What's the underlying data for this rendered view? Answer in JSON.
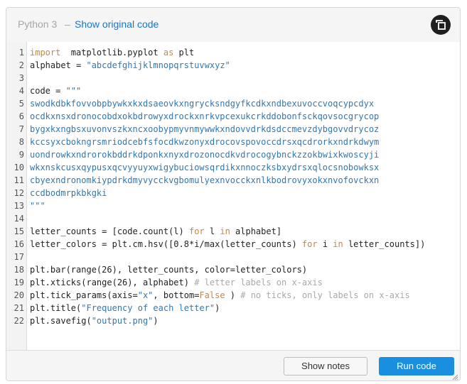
{
  "header": {
    "language": "Python 3",
    "separator": "–",
    "show_original_label": "Show original code",
    "expand_icon": "expand-icon"
  },
  "code": {
    "line_numbers": [
      "1",
      "2",
      "3",
      "4",
      "5",
      "6",
      "7",
      "8",
      "9",
      "10",
      "11",
      "12",
      "13",
      "14",
      "15",
      "16",
      "17",
      "18",
      "19",
      "20",
      "21",
      "22"
    ],
    "lines": [
      [
        [
          "kw",
          "import"
        ],
        [
          "",
          "  matplotlib.pyplot "
        ],
        [
          "kw",
          "as"
        ],
        [
          "",
          " plt"
        ]
      ],
      [
        [
          "",
          "alphabet = "
        ],
        [
          "str",
          "\"abcdefghijklmnopqrstuvwxyz\""
        ]
      ],
      [],
      [
        [
          "",
          "code = "
        ],
        [
          "str",
          "\"\"\""
        ]
      ],
      [
        [
          "str",
          "swodkdbkfovvobpbywkxkxdsaeovkxngrycksndgyfkcdkxndbexuvoccvoqcypcdyx"
        ]
      ],
      [
        [
          "str",
          "ocdkxnsxdronocobdxokbdrowyxdrockxnrkvpcexukcrkddobonfsckqovsocgrycop"
        ]
      ],
      [
        [
          "str",
          "bygxkxngbsxuvonvszkxncxoobypmyvnmywwkxndovvdrkdsdccmevzdybgovvdrycoz"
        ]
      ],
      [
        [
          "str",
          "kccsyxcbokngrsmriodcebfsfocdkwzonyxdrocovspovoccdrsxqcdrorkxndrkdwym"
        ]
      ],
      [
        [
          "str",
          "uondrowkxndrorokbddrkdponkxnyxdrozonocdkvdrocogybnckzzokbwixkwoscyji"
        ]
      ],
      [
        [
          "str",
          "wkxnskcusxqypusxqcvyyuyxwigybuciowsqrdikxnnoczksbxydrsxqlocsnobowksx"
        ]
      ],
      [
        [
          "str",
          "cbyexndronomkiypdrkdmyvycckvgbomulyexnvocckxnlkbodrovyxokxnvofovckxn"
        ]
      ],
      [
        [
          "str",
          "ccdbodmrpkbkgki"
        ]
      ],
      [
        [
          "str",
          "\"\"\""
        ]
      ],
      [],
      [
        [
          "",
          "letter_counts = [code.count(l) "
        ],
        [
          "kw",
          "for"
        ],
        [
          "",
          " l "
        ],
        [
          "kw",
          "in"
        ],
        [
          "",
          " alphabet]"
        ]
      ],
      [
        [
          "",
          "letter_colors = plt.cm.hsv([0.8*i/max(letter_counts) "
        ],
        [
          "kw",
          "for"
        ],
        [
          "",
          " i "
        ],
        [
          "kw",
          "in"
        ],
        [
          "",
          " letter_counts])"
        ]
      ],
      [],
      [
        [
          "",
          "plt.bar(range(26), letter_counts, color=letter_colors)"
        ]
      ],
      [
        [
          "",
          "plt.xticks(range(26), alphabet) "
        ],
        [
          "cm",
          "# letter labels on x-axis"
        ]
      ],
      [
        [
          "",
          "plt.tick_params(axis="
        ],
        [
          "str",
          "\"x\""
        ],
        [
          "",
          ", bottom="
        ],
        [
          "kw",
          "False"
        ],
        [
          "",
          " ) "
        ],
        [
          "cm",
          "# no ticks, only labels on x-axis"
        ]
      ],
      [
        [
          "",
          "plt.title("
        ],
        [
          "str",
          "\"Frequency of each letter\""
        ],
        [
          "",
          ")"
        ]
      ],
      [
        [
          "",
          "plt.savefig("
        ],
        [
          "str",
          "\"output.png\""
        ],
        [
          "",
          ")"
        ]
      ]
    ]
  },
  "footer": {
    "show_notes_label": "Show notes",
    "run_code_label": "Run code"
  },
  "colors": {
    "accent": "#1a8fe0",
    "link": "#1a76c9",
    "keyword": "#c18a44",
    "string": "#2f78b8",
    "comment": "#a9a9a9"
  }
}
